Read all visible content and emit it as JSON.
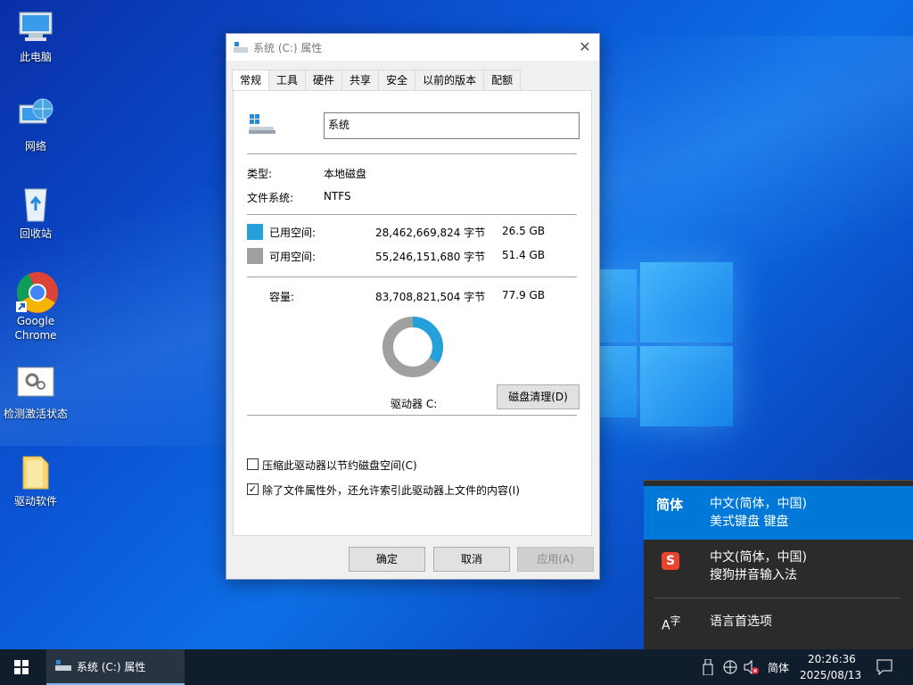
{
  "desktop": {
    "icons": [
      {
        "label": "此电脑"
      },
      {
        "label": "网络"
      },
      {
        "label": "回收站"
      },
      {
        "label": "Google Chrome"
      },
      {
        "label": "检测激活状态"
      },
      {
        "label": "驱动软件"
      }
    ]
  },
  "window": {
    "title": "系统 (C:) 属性",
    "tabs": [
      "常规",
      "工具",
      "硬件",
      "共享",
      "安全",
      "以前的版本",
      "配额"
    ],
    "active_tab": "常规",
    "drive_name": "系统",
    "type_label": "类型:",
    "type_value": "本地磁盘",
    "fs_label": "文件系统:",
    "fs_value": "NTFS",
    "used": {
      "label": "已用空间:",
      "bytes": "28,462,669,824 字节",
      "size": "26.5 GB",
      "color": "#26a0da"
    },
    "free": {
      "label": "可用空间:",
      "bytes": "55,246,151,680 字节",
      "size": "51.4 GB",
      "color": "#a0a0a0"
    },
    "capacity": {
      "label": "容量:",
      "bytes": "83,708,821,504 字节",
      "size": "77.9 GB"
    },
    "used_fraction": 0.34,
    "drive_label": "驱动器 C:",
    "cleanup_button": "磁盘清理(D)",
    "compress_label": "压缩此驱动器以节约磁盘空间(C)",
    "compress_checked": false,
    "index_label": "除了文件属性外，还允许索引此驱动器上文件的内容(I)",
    "index_checked": true,
    "ok": "确定",
    "cancel": "取消",
    "apply": "应用(A)"
  },
  "ime_menu": {
    "items": [
      {
        "tag": "简体",
        "line1": "中文(简体，中国)",
        "line2": "美式键盘 键盘",
        "selected": true
      },
      {
        "tag": "S",
        "line1": "中文(简体，中国)",
        "line2": "搜狗拼音输入法",
        "selected": false
      }
    ],
    "language_prefs": "语言首选项"
  },
  "taskbar": {
    "app_title": "系统 (C:) 属性",
    "ime_indicator": "简体",
    "time": "20:26:36",
    "date": "2025/08/13"
  },
  "colors": {
    "accent": "#0078d7",
    "used": "#26a0da",
    "free": "#a0a0a0",
    "taskbar": "#101d2d"
  }
}
